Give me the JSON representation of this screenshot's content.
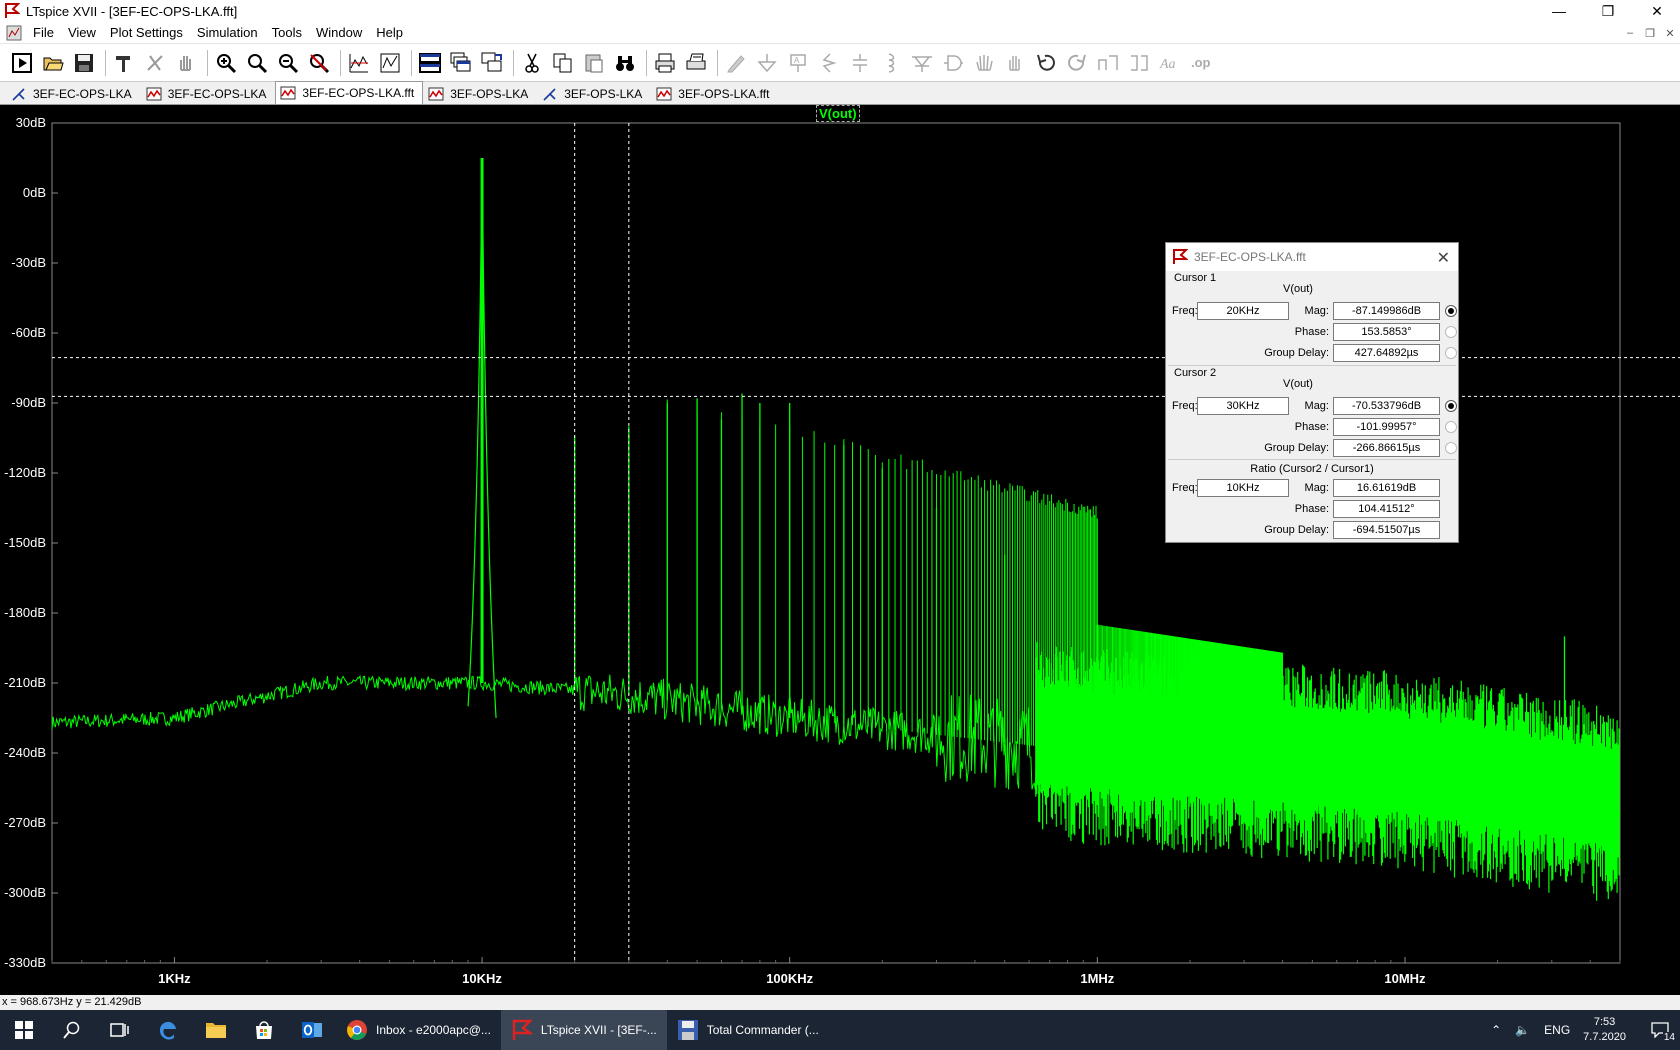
{
  "window": {
    "title": "LTspice XVII - [3EF-EC-OPS-LKA.fft]"
  },
  "menubar": {
    "items": [
      "File",
      "View",
      "Plot Settings",
      "Simulation",
      "Tools",
      "Window",
      "Help"
    ]
  },
  "tabs": [
    {
      "label": "3EF-EC-OPS-LKA",
      "kind": "schematic-icon"
    },
    {
      "label": "3EF-EC-OPS-LKA",
      "kind": "waveform-icon"
    },
    {
      "label": "3EF-EC-OPS-LKA.fft",
      "kind": "waveform-icon"
    },
    {
      "label": "3EF-OPS-LKA",
      "kind": "waveform-icon"
    },
    {
      "label": "3EF-OPS-LKA",
      "kind": "schematic-icon"
    },
    {
      "label": "3EF-OPS-LKA.fft",
      "kind": "waveform-icon"
    }
  ],
  "plot": {
    "trace_label": "V(out)",
    "trace_color": "#00ff00",
    "y_ticks": [
      "30dB",
      "0dB",
      "-30dB",
      "-60dB",
      "-90dB",
      "-120dB",
      "-150dB",
      "-180dB",
      "-210dB",
      "-240dB",
      "-270dB",
      "-300dB",
      "-330dB"
    ],
    "x_ticks": [
      "1KHz",
      "10KHz",
      "100KHz",
      "1MHz",
      "10MHz"
    ]
  },
  "chart_data": {
    "type": "line",
    "title": "V(out)",
    "x_scale": "log",
    "xlim_hz": [
      400,
      50000000
    ],
    "ylim_db": [
      -330,
      30
    ],
    "series": [
      {
        "name": "V(out)",
        "color": "#00ff00",
        "peaks_db": [
          {
            "x_hz": 10000,
            "y_db": 15
          },
          {
            "x_hz": 20000,
            "y_db": -104
          },
          {
            "x_hz": 30000,
            "y_db": -100
          },
          {
            "x_hz": 40000,
            "y_db": -90
          },
          {
            "x_hz": 50000,
            "y_db": -88
          },
          {
            "x_hz": 60000,
            "y_db": -97
          },
          {
            "x_hz": 70000,
            "y_db": -86
          },
          {
            "x_hz": 80000,
            "y_db": -90
          },
          {
            "x_hz": 100000,
            "y_db": -90
          },
          {
            "x_hz": 150000,
            "y_db": -108
          },
          {
            "x_hz": 200000,
            "y_db": -118
          },
          {
            "x_hz": 300000,
            "y_db": -135
          },
          {
            "x_hz": 500000,
            "y_db": -155
          },
          {
            "x_hz": 1000000,
            "y_db": -185
          },
          {
            "x_hz": 33000000,
            "y_db": -190
          }
        ],
        "floor_db": [
          {
            "x_hz": 400,
            "y_db": -227
          },
          {
            "x_hz": 1000,
            "y_db": -225
          },
          {
            "x_hz": 3000,
            "y_db": -210
          },
          {
            "x_hz": 10000,
            "y_db": -210
          },
          {
            "x_hz": 30000,
            "y_db": -215
          },
          {
            "x_hz": 100000,
            "y_db": -225
          },
          {
            "x_hz": 1000000,
            "y_db": -240
          },
          {
            "x_hz": 10000000,
            "y_db": -250
          },
          {
            "x_hz": 50000000,
            "y_db": -265
          }
        ]
      }
    ],
    "cursors": {
      "cursor1_hz": 20000,
      "cursor1_db": -87.149986,
      "cursor2_hz": 30000,
      "cursor2_db": -70.533796
    }
  },
  "cursor_dialog": {
    "title": "3EF-EC-OPS-LKA.fft",
    "cursor1": {
      "header": "Cursor 1",
      "trace": "V(out)",
      "freq_label": "Freq:",
      "freq": "20KHz",
      "mag_label": "Mag:",
      "mag": "-87.149986dB",
      "phase_label": "Phase:",
      "phase": "153.5853°",
      "gd_label": "Group Delay:",
      "gd": "427.64892µs"
    },
    "cursor2": {
      "header": "Cursor 2",
      "trace": "V(out)",
      "freq_label": "Freq:",
      "freq": "30KHz",
      "mag_label": "Mag:",
      "mag": "-70.533796dB",
      "phase_label": "Phase:",
      "phase": "-101.99957°",
      "gd_label": "Group Delay:",
      "gd": "-266.86615µs"
    },
    "ratio": {
      "header": "Ratio (Cursor2 / Cursor1)",
      "freq_label": "Freq:",
      "freq": "10KHz",
      "mag_label": "Mag:",
      "mag": "16.61619dB",
      "phase_label": "Phase:",
      "phase": "104.41512°",
      "gd_label": "Group Delay:",
      "gd": "-694.51507µs"
    }
  },
  "statusbar": {
    "text": "x = 968.673Hz   y = 21.429dB"
  },
  "taskbar": {
    "apps": [
      {
        "label": "Inbox - e2000apc@...",
        "active": false,
        "icon": "chrome-icon"
      },
      {
        "label": "LTspice XVII - [3EF-...",
        "active": true,
        "icon": "ltspice-icon"
      },
      {
        "label": "Total Commander (...",
        "active": false,
        "icon": "floppy-icon"
      }
    ],
    "tray": {
      "lang": "ENG",
      "time": "7:53",
      "date": "7.7.2020",
      "notifications": "14"
    }
  }
}
